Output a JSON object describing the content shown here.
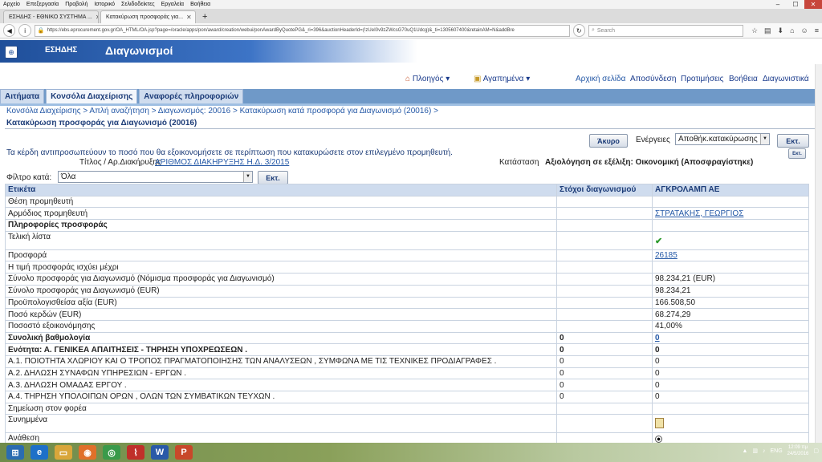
{
  "browser": {
    "menu": [
      "Αρχείο",
      "Επεξεργασία",
      "Προβολή",
      "Ιστορικό",
      "Σελιδοδείκτες",
      "Εργαλεία",
      "Βοήθεια"
    ],
    "tabs": [
      {
        "label": "ΕΣΗΔΗΣ - ΕΘΝΙΚΟ ΣΥΣΤΗΜΑ ..."
      },
      {
        "label": "Κατακύρωση προσφοράς για..."
      }
    ],
    "url": "https://ebs.eprocurement.gov.gr/OA_HTML/OA.jsp?page=/oracle/apps/pon/award/creation/webui/ponAwardByQuotePG&_ri=396&auctionHeaderId=(!zUeI0v9zZWcsG70uQ1Udcg)&_ti=1305607400&retainAM=N&addBre",
    "search_placeholder": "Search"
  },
  "header": {
    "logo_text": "ΕΣΗΔΗΣ",
    "app_title": "Διαγωνισμοί",
    "global_nav": [
      "Πλοηγός",
      "Αγαπημένα",
      "Αρχική σελίδα",
      "Αποσύνδεση",
      "Προτιμήσεις",
      "Βοήθεια",
      "Διαγωνιστικά"
    ]
  },
  "tabs": [
    "Αιτήματα",
    "Κονσόλα Διαχείρισης",
    "Αναφορές πληροφοριών"
  ],
  "breadcrumbs": "Κονσόλα Διαχείρισης  >  Απλή αναζήτηση  >  Διαγωνισμός: 20016  >  Κατακύρωση κατά προσφορά για Διαγωνισμό (20016)  >",
  "page_title": "Κατακύρωση προσφοράς για Διαγωνισμό (20016)",
  "actions": {
    "cancel": "Άκυρο",
    "actions_label": "Ενέργειες",
    "action_select": "Αποθήκ.κατακύρωσης",
    "go": "Εκτ.",
    "go_small": "Εκτ."
  },
  "info_text": "Τα κέρδη αντιπροσωπεύουν το ποσό που θα εξοικονομήσετε σε περίπτωση που κατακυρώσετε στον επιλεγμένο προμηθευτή.",
  "title_label": "Τίτλος / Αρ.Διακήρυξης",
  "title_value": "ΑΡΙΘΜΟΣ ΔΙΑΚΗΡΥΞΗΣ Η.Δ. 3/2015",
  "status_label": "Κατάσταση",
  "status_value": "Αξιολόγηση σε εξέλιξη: Οικονομική (Αποσφραγίστηκε)",
  "filter": {
    "label": "Φίλτρο κατά:",
    "value": "Όλα",
    "go": "Εκτ."
  },
  "table": {
    "headers": [
      "Ετικέτα",
      "Στόχοι διαγωνισμού",
      "ΑΓΚΡΟΛΑΜΠ ΑΕ"
    ],
    "rows": [
      {
        "label": "Θέση προμηθευτή",
        "target": "",
        "value": "",
        "bold": false
      },
      {
        "label": "Αρμόδιος προμηθευτή",
        "target": "",
        "value": "ΣΤΡΑΤΑΚΗΣ, ΓΕΩΡΓΙΟΣ",
        "bold": false,
        "link": true
      },
      {
        "label": "Πληροφορίες προσφοράς",
        "target": "",
        "value": "",
        "bold": true
      },
      {
        "label": "Τελική λίστα",
        "target": "",
        "value": "✔",
        "bold": false,
        "tall": true,
        "check": true
      },
      {
        "label": "Προσφορά",
        "target": "",
        "value": "26185",
        "bold": false,
        "link": true
      },
      {
        "label": "Η τιμή προσφοράς ισχύει μέχρι",
        "target": "",
        "value": "",
        "bold": false
      },
      {
        "label": "Σύνολο προσφοράς για Διαγωνισμό (Νόμισμα προσφοράς για Διαγωνισμό)",
        "target": "",
        "value": "98.234,21 (EUR)",
        "bold": false
      },
      {
        "label": "Σύνολο προσφοράς για Διαγωνισμό (EUR)",
        "target": "",
        "value": "98.234,21",
        "bold": false
      },
      {
        "label": "Προϋπολογισθείσα αξία (EUR)",
        "target": "",
        "value": "166.508,50",
        "bold": false
      },
      {
        "label": "Ποσό κερδών (EUR)",
        "target": "",
        "value": "68.274,29",
        "bold": false
      },
      {
        "label": "Ποσοστό εξοικονόμησης",
        "target": "",
        "value": "41,00%",
        "bold": false
      },
      {
        "label": "Συνολική βαθμολογία",
        "target": "0",
        "value": "0",
        "bold": true,
        "link": true
      },
      {
        "label": "Ενότητα: Α. ΓΕΝΙΚΕΑ ΑΠΑΙΤΗΣΕΙΣ - ΤΗΡΗΣΗ ΥΠΟΧΡΕΩΣΕΩΝ .",
        "target": "0",
        "value": "0",
        "bold": true
      },
      {
        "label": "Α.1. ΠΟΙΟΤΗΤΑ ΧΛΩΡΙΟΥ ΚΑΙ Ο ΤΡΟΠΟΣ ΠΡΑΓΜΑΤΟΠΟΙΗΣΗΣ ΤΩΝ ΑΝΑΛΥΣΕΩΝ , ΣΥΜΦΩΝΑ ΜΕ ΤΙΣ ΤΕΧΝΙΚΕΣ ΠΡΟΔΙΑΓΡΑΦΕΣ .",
        "target": "0",
        "value": "0",
        "bold": false
      },
      {
        "label": "Α.2. ΔΗΛΩΣΗ ΣΥΝΑΦΩΝ ΥΠΗΡΕΣΙΩΝ - ΕΡΓΩΝ .",
        "target": "0",
        "value": "0",
        "bold": false
      },
      {
        "label": "Α.3. ΔΗΛΩΣΗ ΟΜΑΔΑΣ ΕΡΓΟΥ .",
        "target": "0",
        "value": "0",
        "bold": false
      },
      {
        "label": "Α.4. ΤΗΡΗΣΗ ΥΠΟΛΟΙΠΩΝ ΟΡΩΝ , ΟΛΩΝ ΤΩΝ ΣΥΜΒΑΤΙΚΩΝ ΤΕΥΧΩΝ .",
        "target": "0",
        "value": "0",
        "bold": false
      },
      {
        "label": "Σημείωση στον φορέα",
        "target": "",
        "value": "",
        "bold": false
      },
      {
        "label": "Συνημμένα",
        "target": "",
        "value": "",
        "bold": false,
        "tall": true,
        "icon": "attachment-icon"
      },
      {
        "label": "Ανάθεση",
        "target": "",
        "value": "",
        "bold": false,
        "tall": true,
        "radio": true
      }
    ]
  },
  "taskbar": {
    "lang": "ENG",
    "time": "12:09 πμ",
    "date": "24/5/2016"
  },
  "colors": {
    "brand_blue": "#1f4f9a",
    "link": "#2458a6",
    "header_cell": "#cfdcee",
    "check_green": "#2c9a2c"
  }
}
